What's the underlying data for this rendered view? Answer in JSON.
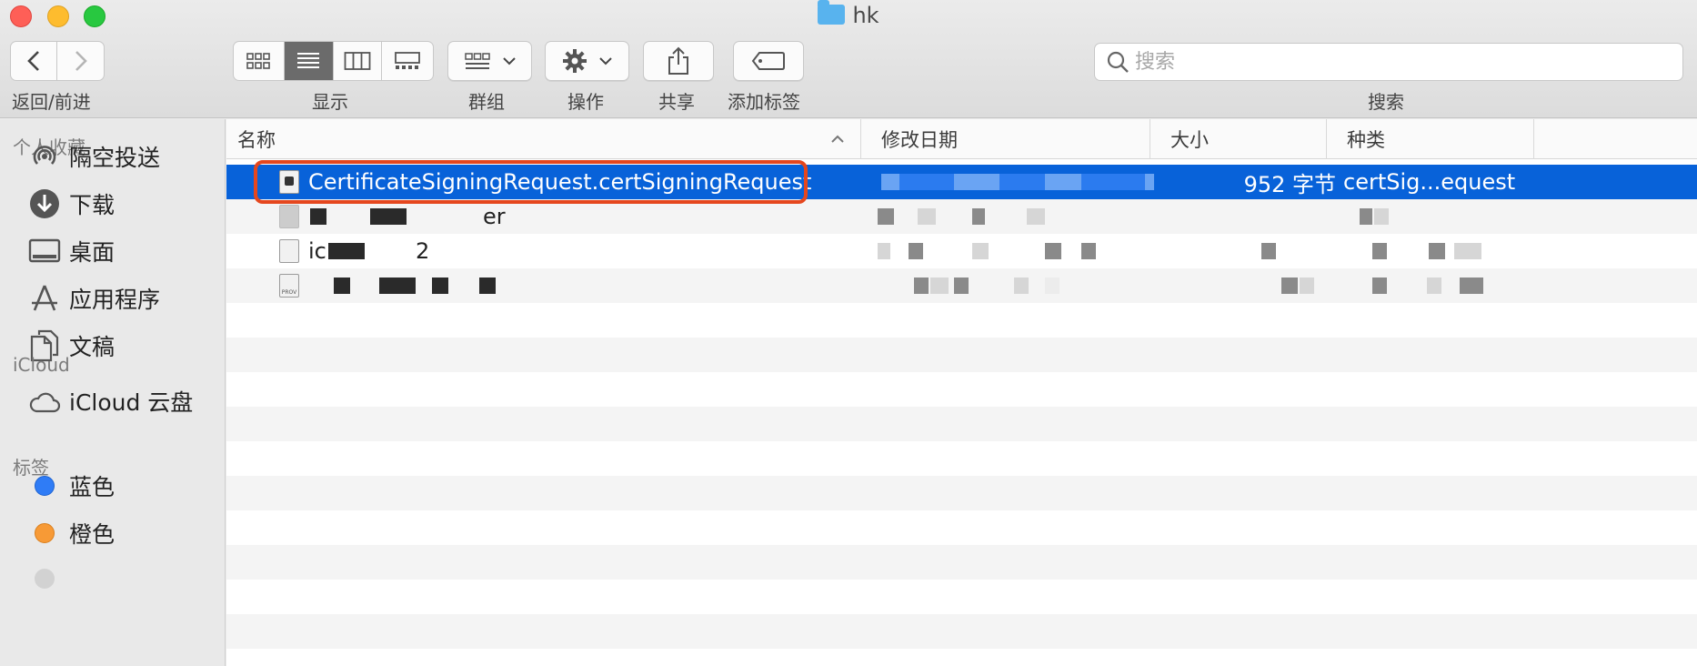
{
  "window": {
    "title": "hk"
  },
  "toolbar": {
    "nav_label": "返回/前进",
    "view_label": "显示",
    "group_label": "群组",
    "action_label": "操作",
    "share_label": "共享",
    "tags_label": "添加标签",
    "search_label": "搜索",
    "search_placeholder": "搜索",
    "view_active": "list"
  },
  "sidebar": {
    "favorites_header": "个人收藏",
    "favorites": [
      {
        "label": "隔空投送",
        "icon": "airdrop-icon"
      },
      {
        "label": "下载",
        "icon": "downloads-icon"
      },
      {
        "label": "桌面",
        "icon": "desktop-icon"
      },
      {
        "label": "应用程序",
        "icon": "applications-icon"
      },
      {
        "label": "文稿",
        "icon": "documents-icon"
      }
    ],
    "icloud_header": "iCloud",
    "icloud": [
      {
        "label": "iCloud 云盘",
        "icon": "cloud-icon"
      }
    ],
    "tags_header": "标签",
    "tags": [
      {
        "label": "蓝色",
        "color": "#2f7cf6"
      },
      {
        "label": "橙色",
        "color": "#f79a36"
      }
    ]
  },
  "columns": {
    "name": "名称",
    "modified": "修改日期",
    "size": "大小",
    "kind": "种类"
  },
  "files": [
    {
      "name": "CertificateSigningRequest.certSigningRequest",
      "size": "952 字节",
      "kind": "certSig...equest",
      "selected": true
    },
    {
      "name": "er",
      "size": "",
      "kind": "",
      "selected": false
    },
    {
      "name": "ic",
      "name_tail": "2",
      "size": "",
      "kind": "",
      "selected": false
    },
    {
      "name": "",
      "size": "",
      "kind": "",
      "selected": false
    }
  ],
  "icon_labels": {
    "prov": "PROV"
  },
  "colors": {
    "selection": "#0862d9",
    "highlight_box": "#e5471e"
  }
}
